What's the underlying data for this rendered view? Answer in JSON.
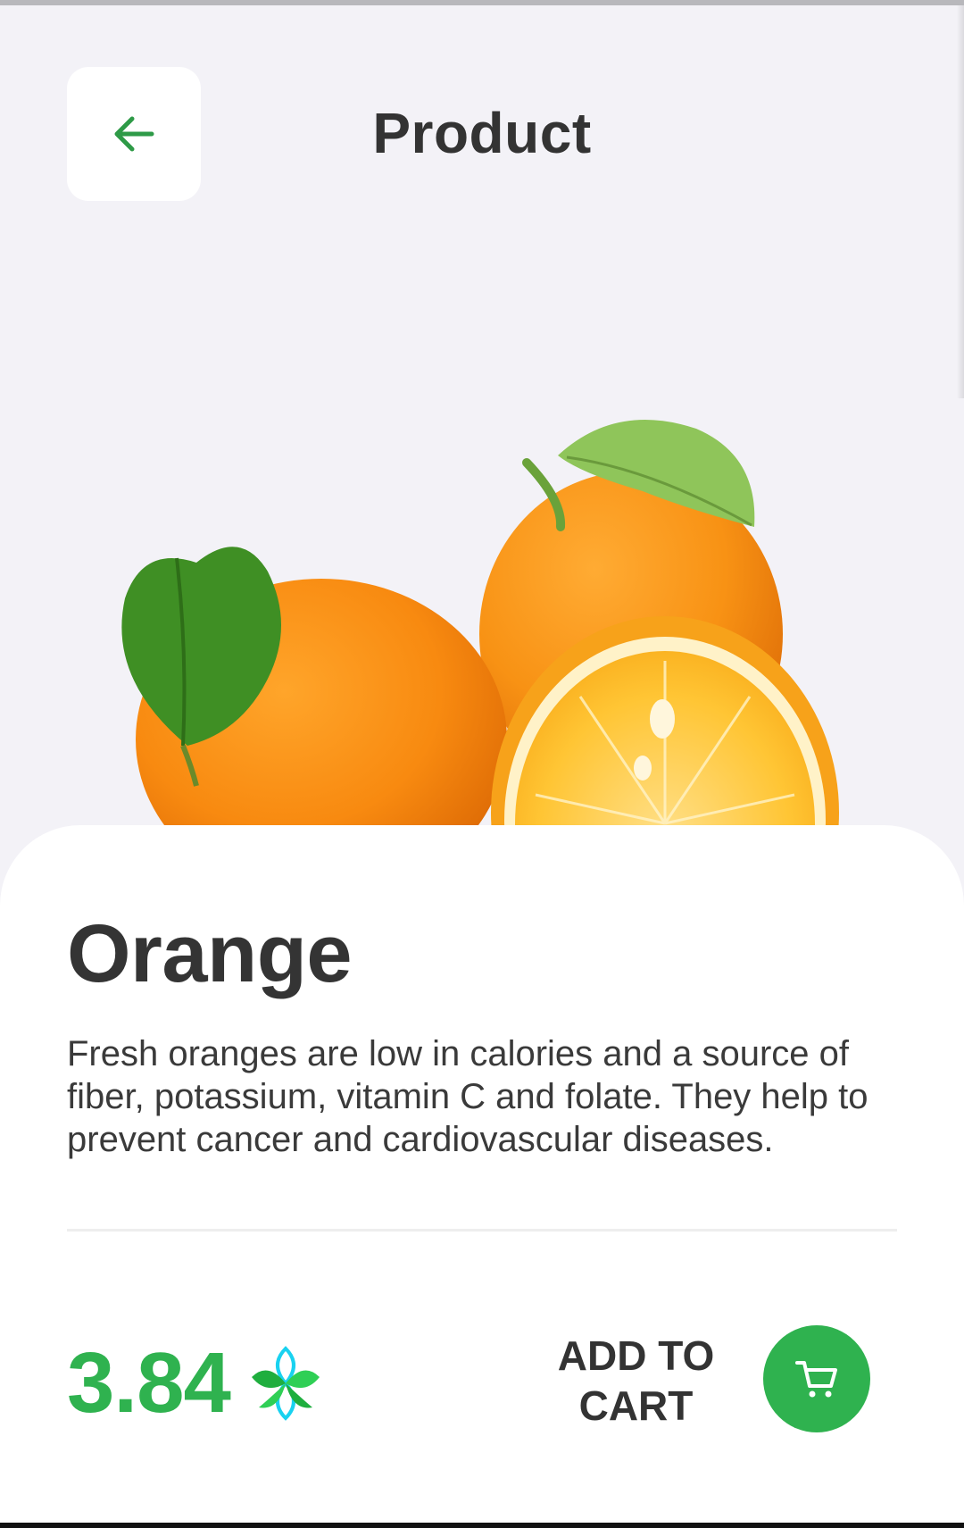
{
  "header": {
    "title": "Product",
    "back_icon": "arrow-left-icon"
  },
  "product": {
    "name": "Orange",
    "description": "Fresh oranges are low in calories and a source of fiber, potassium, vitamin C and folate. They help to prevent cancer and cardiovascular diseases.",
    "price": "3.84",
    "currency_icon": "leaf-coin-icon",
    "image": "oranges-image"
  },
  "actions": {
    "add_to_cart_label": "ADD TO CART",
    "cart_icon": "cart-icon"
  },
  "colors": {
    "accent": "#2fb24f",
    "background": "#f3f2f7",
    "card": "#ffffff",
    "text": "#333333"
  }
}
